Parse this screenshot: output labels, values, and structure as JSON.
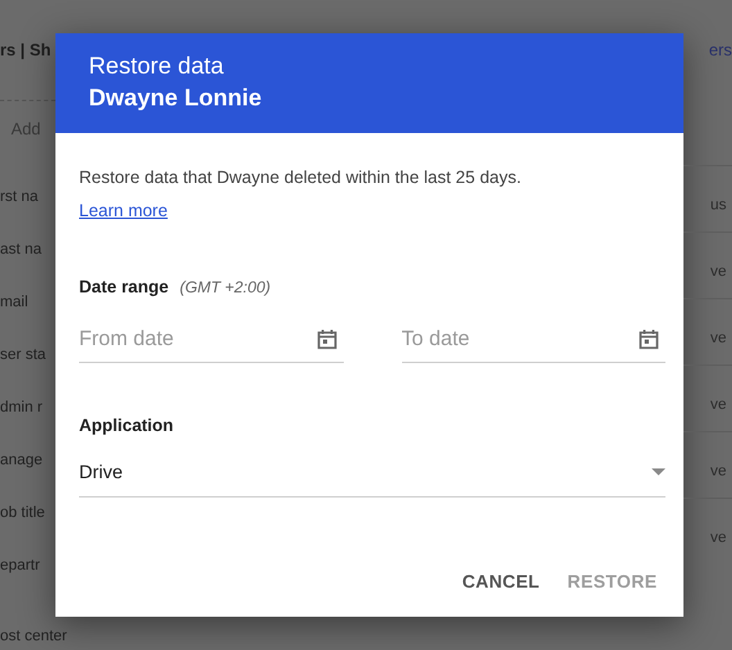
{
  "background": {
    "header_left": "rs | Sh",
    "header_right": "ers",
    "add_button": "Add",
    "left_rows": [
      "rst na",
      "ast na",
      "mail",
      "ser sta",
      "dmin r",
      "anage",
      "ob title",
      "epartr",
      "ost center"
    ],
    "right_rows": [
      "us",
      "ve",
      "ve",
      "ve",
      "ve",
      "ve"
    ]
  },
  "dialog": {
    "title": "Restore data",
    "subtitle": "Dwayne Lonnie",
    "description": "Restore data that Dwayne deleted within the last 25 days.",
    "link": "Learn more",
    "date_range": {
      "label": "Date range",
      "timezone": "(GMT +2:00)",
      "fields": [
        {
          "placeholder": "From date"
        },
        {
          "placeholder": "To date"
        }
      ]
    },
    "application": {
      "label": "Application",
      "value": "Drive"
    },
    "buttons": [
      {
        "label": "CANCEL",
        "disabled": false
      },
      {
        "label": "RESTORE",
        "disabled": true
      }
    ]
  }
}
